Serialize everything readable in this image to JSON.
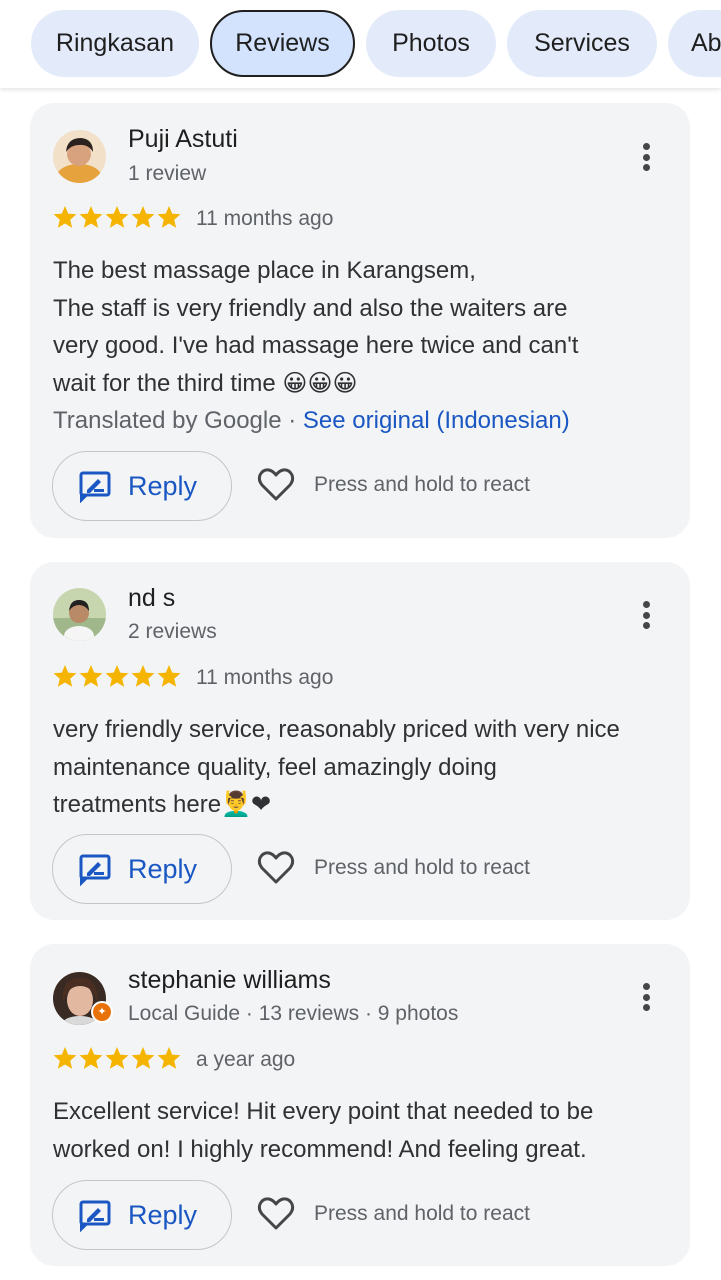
{
  "tabs": [
    {
      "label": "Ringkasan"
    },
    {
      "label": "Reviews"
    },
    {
      "label": "Photos"
    },
    {
      "label": "Services"
    },
    {
      "label": "Ab"
    }
  ],
  "active_tab": "Reviews",
  "reply_label": "Reply",
  "react_label": "Press and hold to react",
  "rating_stars": 5,
  "star_color": "#f4b400",
  "link_color": "#1a57c2",
  "icons": {
    "reply": "rate-review-icon",
    "react": "heart-outline-icon",
    "more": "more-vert-icon",
    "star": "star-icon"
  },
  "reviews": [
    {
      "name": "Puji Astuti",
      "meta": "1 review",
      "time": "11 months ago",
      "text_lines": [
        "The best massage place in Karangsem,",
        "The staff is very friendly and also the waiters are",
        "very good. I've had massage here twice and can't",
        "wait for the third time 😀😀😀"
      ],
      "translated_by": "Translated by Google · ",
      "see_original": "See original (Indonesian)"
    },
    {
      "name": "nd s",
      "meta": "2 reviews",
      "time": "11 months ago",
      "text_lines": [
        "very friendly service, reasonably priced with very nice",
        "maintenance quality, feel amazingly doing",
        "treatments here💆‍♂️❤"
      ]
    },
    {
      "name": "stephanie williams",
      "meta": "Local Guide · 13 reviews · 9 photos",
      "time": "a year ago",
      "text_lines": [
        "Excellent service! Hit every point that needed to be",
        "worked on! I highly recommend! And feeling great."
      ]
    }
  ]
}
